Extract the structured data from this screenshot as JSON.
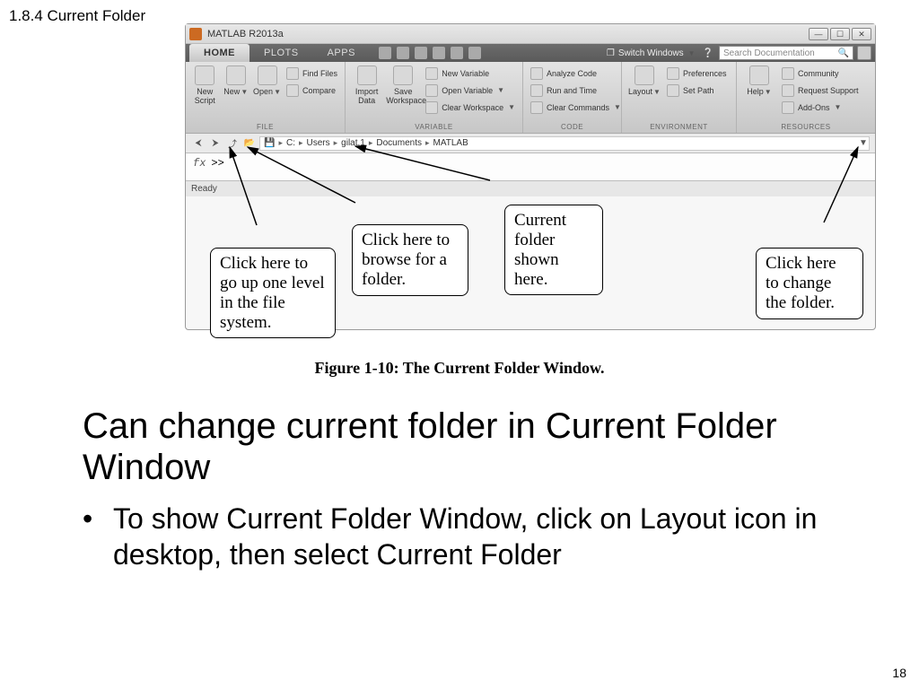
{
  "section_heading": "1.8.4 Current Folder",
  "window": {
    "title": "MATLAB R2013a",
    "tabs": {
      "home": "HOME",
      "plots": "PLOTS",
      "apps": "APPS"
    },
    "switch_windows": "Switch Windows",
    "search_placeholder": "Search Documentation",
    "ribbon": {
      "file_label": "FILE",
      "new_script": "New\nScript",
      "new": "New",
      "open": "Open",
      "find_files": "Find Files",
      "compare": "Compare",
      "variable_label": "VARIABLE",
      "import_data": "Import\nData",
      "save_workspace": "Save\nWorkspace",
      "new_variable": "New Variable",
      "open_variable": "Open Variable",
      "clear_workspace": "Clear Workspace",
      "code_label": "CODE",
      "analyze_code": "Analyze Code",
      "run_and_time": "Run and Time",
      "clear_commands": "Clear Commands",
      "environment_label": "ENVIRONMENT",
      "layout": "Layout",
      "preferences": "Preferences",
      "set_path": "Set Path",
      "resources_label": "RESOURCES",
      "help": "Help",
      "community": "Community",
      "request_support": "Request Support",
      "addons": "Add-Ons"
    },
    "path": {
      "c": "C:",
      "users": "Users",
      "user": "gilat.1",
      "documents": "Documents",
      "matlab": "MATLAB"
    },
    "prompt_fx": "fx",
    "prompt": ">>",
    "status": "Ready"
  },
  "callouts": {
    "up": "Click here to go up one level in the file system.",
    "browse": "Click here to browse for a folder.",
    "shown": "Current folder shown here.",
    "change": "Click here to change the folder."
  },
  "caption_bold": "Figure 1-10:",
  "caption_rest": "  The Current Folder Window.",
  "headline": "Can change current folder in Current Folder Window",
  "bullet1": "To show Current Folder Window, click on Layout icon in desktop, then select Current Folder",
  "page_number": "18"
}
